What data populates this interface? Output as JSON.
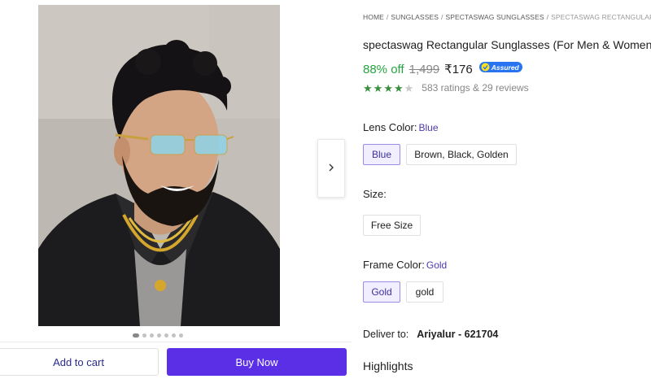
{
  "gallery": {
    "image_alt": "Man wearing blue tinted rimless rectangular sunglasses with gold temples",
    "next_arrow_icon": "chevron-right-icon",
    "dots_count": 7,
    "active_dot": 0
  },
  "actions": {
    "add_to_cart": "Add to cart",
    "buy_now": "Buy Now"
  },
  "breadcrumb": [
    "HOME",
    "SUNGLASSES",
    "SPECTASWAG SUNGLASSES",
    "SPECTASWAG RECTANGULAR SUNGLASSES"
  ],
  "product": {
    "title": "spectaswag Rectangular Sunglasses (For Men & Women, Blue)",
    "discount": "88% off",
    "mrp": "1,499",
    "price": "₹176",
    "assured_label": "Assured",
    "rating": 4,
    "rating_max": 5,
    "ratings_text": "583 ratings & 29 reviews"
  },
  "lens_color": {
    "label": "Lens Color:",
    "selected": "Blue",
    "options": [
      "Blue",
      "Brown, Black, Golden"
    ]
  },
  "size": {
    "label": "Size:",
    "options": [
      "Free Size"
    ]
  },
  "frame_color": {
    "label": "Frame Color:",
    "selected": "Gold",
    "options": [
      "Gold",
      "gold"
    ]
  },
  "delivery": {
    "label": "Deliver to:",
    "location": "Ariyalur - 621704"
  },
  "highlights": {
    "heading": "Highlights"
  },
  "colors": {
    "buy_button": "#5a2fe6",
    "discount_green": "#26a541",
    "star_green": "#388e3c",
    "assured_blue": "#2874f0"
  }
}
